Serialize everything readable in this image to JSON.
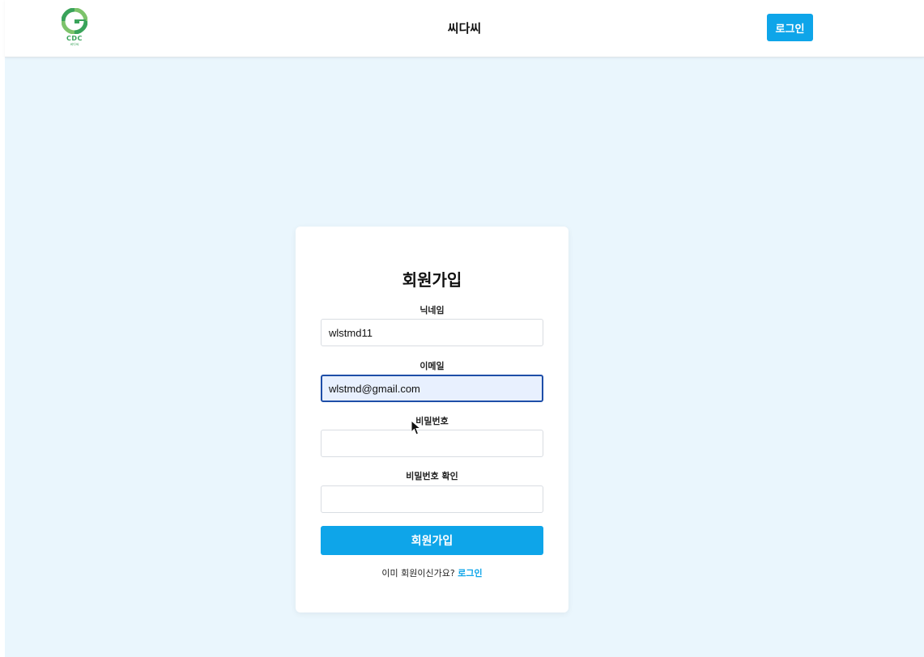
{
  "header": {
    "logo_text": "CDC",
    "logo_subtext": "씨다씨",
    "title": "씨다씨",
    "login_label": "로그인"
  },
  "signup": {
    "title": "회원가입",
    "fields": [
      {
        "label": "닉네임",
        "value": "wlstmd11",
        "placeholder": ""
      },
      {
        "label": "이메일",
        "value": "wlstmd@gmail.com",
        "placeholder": ""
      },
      {
        "label": "비밀번호",
        "value": "",
        "placeholder": ""
      },
      {
        "label": "비밀번호 확인",
        "value": "",
        "placeholder": ""
      }
    ],
    "submit_label": "회원가입",
    "footer_text": "이미 회원이신가요?",
    "footer_link": "로그인"
  },
  "colors": {
    "accent": "#0ea5e9",
    "background": "#eaf6fd",
    "logo_green": "#3aa35b"
  }
}
